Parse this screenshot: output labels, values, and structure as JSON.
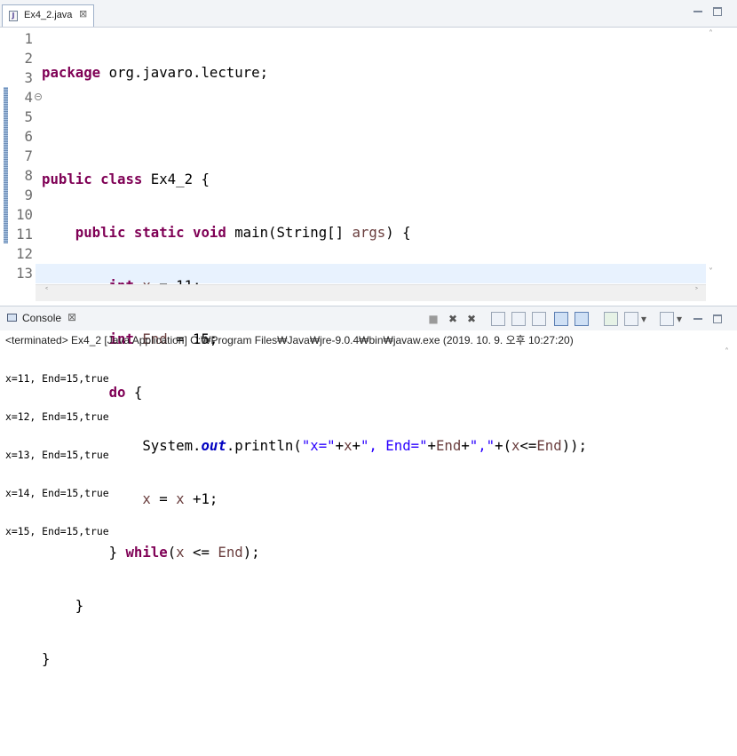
{
  "editor": {
    "tab_label": "Ex4_2.java",
    "file_icon_letter": "J",
    "close_glyph": "⊠"
  },
  "code": {
    "lines": [
      "1",
      "2",
      "3",
      "4",
      "5",
      "6",
      "7",
      "8",
      "9",
      "10",
      "11",
      "12",
      "13"
    ],
    "fold_glyph": "−",
    "tokens": {
      "l1_kw": "package",
      "l1_rest": " org.javaro.lecture;",
      "l3_kw": "public class",
      "l3_rest": " Ex4_2 {",
      "l4_indent": "    ",
      "l4_kw": "public static void",
      "l4_mid": " main(String[] ",
      "l4_var": "args",
      "l4_end": ") {",
      "l5_indent": "        ",
      "l5_kw": "int",
      "l5_sp": " ",
      "l5_var": "x",
      "l5_rest": " = 11;",
      "l6_indent": "        ",
      "l6_kw": "int",
      "l6_sp": " ",
      "l6_var": "End",
      "l6_rest": " = 15;",
      "l7_indent": "        ",
      "l7_kw": "do",
      "l7_rest": " {",
      "l8_indent": "            ",
      "l8_pre": "System.",
      "l8_fld": "out",
      "l8_call": ".println(",
      "l8_s1": "\"x=\"",
      "l8_p1": "+",
      "l8_v1": "x",
      "l8_p2": "+",
      "l8_s2": "\", End=\"",
      "l8_p3": "+",
      "l8_v2": "End",
      "l8_p4": "+",
      "l8_s3": "\",\"",
      "l8_p5": "+(",
      "l8_v3": "x",
      "l8_p6": "<=",
      "l8_v4": "End",
      "l8_end": "));",
      "l9_indent": "            ",
      "l9_v1": "x",
      "l9_mid": " = ",
      "l9_v2": "x",
      "l9_end": " +1;",
      "l10_indent": "        ",
      "l10_pre": "} ",
      "l10_kw": "while",
      "l10_open": "(",
      "l10_v1": "x",
      "l10_op": " <= ",
      "l10_v2": "End",
      "l10_end": ");",
      "l11_text": "    }",
      "l12_text": "}"
    }
  },
  "console": {
    "tab_label": "Console",
    "close_glyph": "⊠",
    "status": "<terminated> Ex4_2 [Java Application] C:₩Program Files₩Java₩jre-9.0.4₩bin₩javaw.exe (2019. 10. 9. 오후 10:27:20)",
    "output": [
      "x=11, End=15,true",
      "x=12, End=15,true",
      "x=13, End=15,true",
      "x=14, End=15,true",
      "x=15, End=15,true"
    ],
    "toolbar_glyphs": {
      "terminate": "■",
      "remove": "✖",
      "remove_all": "✖",
      "dropdown": "▾"
    }
  },
  "scroll": {
    "up": "˄",
    "down": "˅",
    "left": "˂",
    "right": "˃"
  },
  "colors": {
    "keyword": "#7f0055",
    "string": "#2a00ff",
    "local_var": "#6a3e3e",
    "field": "#0000c0",
    "current_line": "#e8f2fe"
  }
}
